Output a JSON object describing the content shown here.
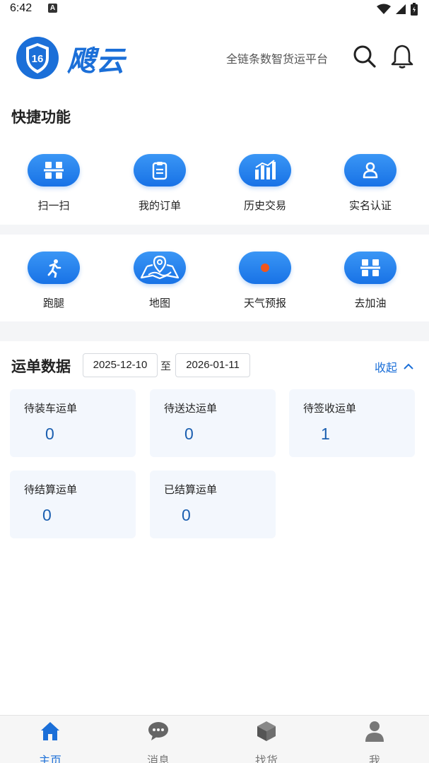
{
  "status_bar": {
    "time": "6:42",
    "notification_letter": "A"
  },
  "header": {
    "brand": "飕云",
    "shield_number": "16",
    "slogan": "全链条数智货运平台"
  },
  "quick_functions": {
    "title": "快捷功能",
    "row1": [
      {
        "label": "扫一扫",
        "icon": "scan-icon"
      },
      {
        "label": "我的订单",
        "icon": "clipboard-icon"
      },
      {
        "label": "历史交易",
        "icon": "bar-chart-icon"
      },
      {
        "label": "实名认证",
        "icon": "user-verify-icon"
      }
    ],
    "row2": [
      {
        "label": "跑腿",
        "icon": "runner-icon"
      },
      {
        "label": "地图",
        "icon": "map-icon"
      },
      {
        "label": "天气预报",
        "icon": "weather-icon"
      },
      {
        "label": "去加油",
        "icon": "fuel-icon"
      }
    ]
  },
  "waybill": {
    "title": "运单数据",
    "date_from": "2025-12-10",
    "date_sep": "至",
    "date_to": "2026-01-11",
    "collapse_label": "收起",
    "cards": [
      {
        "label": "待装车运单",
        "value": "0"
      },
      {
        "label": "待送达运单",
        "value": "0"
      },
      {
        "label": "待签收运单",
        "value": "1"
      },
      {
        "label": "待结算运单",
        "value": "0"
      },
      {
        "label": "已结算运单",
        "value": "0"
      }
    ]
  },
  "bottom_nav": [
    {
      "label": "主页",
      "icon": "home-icon",
      "active": true
    },
    {
      "label": "消息",
      "icon": "message-icon",
      "active": false
    },
    {
      "label": "找货",
      "icon": "package-icon",
      "active": false
    },
    {
      "label": "我",
      "icon": "person-icon",
      "active": false
    }
  ],
  "colors": {
    "accent": "#1b6fd8",
    "card_bg": "#f3f7fd",
    "band_bg": "#f4f5f7"
  }
}
